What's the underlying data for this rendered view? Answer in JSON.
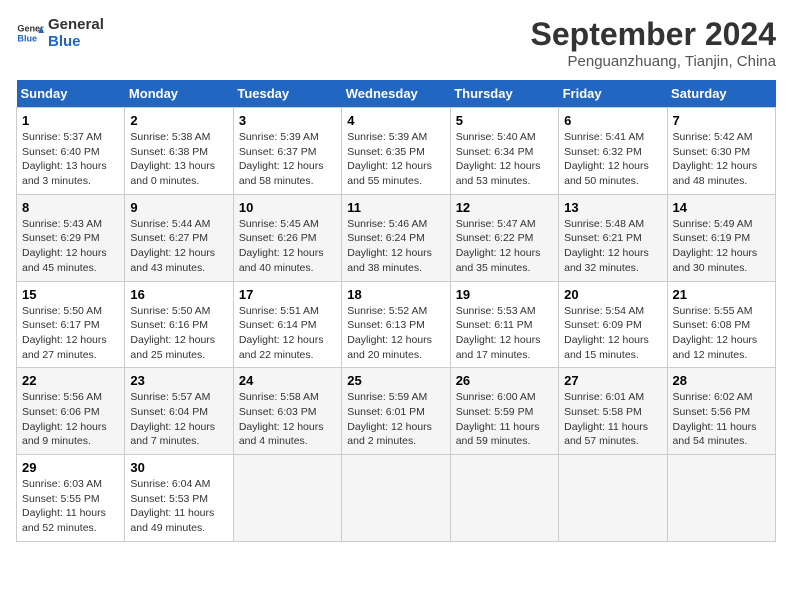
{
  "header": {
    "logo_line1": "General",
    "logo_line2": "Blue",
    "title": "September 2024",
    "subtitle": "Penguanzhuang, Tianjin, China"
  },
  "days_of_week": [
    "Sunday",
    "Monday",
    "Tuesday",
    "Wednesday",
    "Thursday",
    "Friday",
    "Saturday"
  ],
  "weeks": [
    [
      {
        "day": "1",
        "info": "Sunrise: 5:37 AM\nSunset: 6:40 PM\nDaylight: 13 hours\nand 3 minutes."
      },
      {
        "day": "2",
        "info": "Sunrise: 5:38 AM\nSunset: 6:38 PM\nDaylight: 13 hours\nand 0 minutes."
      },
      {
        "day": "3",
        "info": "Sunrise: 5:39 AM\nSunset: 6:37 PM\nDaylight: 12 hours\nand 58 minutes."
      },
      {
        "day": "4",
        "info": "Sunrise: 5:39 AM\nSunset: 6:35 PM\nDaylight: 12 hours\nand 55 minutes."
      },
      {
        "day": "5",
        "info": "Sunrise: 5:40 AM\nSunset: 6:34 PM\nDaylight: 12 hours\nand 53 minutes."
      },
      {
        "day": "6",
        "info": "Sunrise: 5:41 AM\nSunset: 6:32 PM\nDaylight: 12 hours\nand 50 minutes."
      },
      {
        "day": "7",
        "info": "Sunrise: 5:42 AM\nSunset: 6:30 PM\nDaylight: 12 hours\nand 48 minutes."
      }
    ],
    [
      {
        "day": "8",
        "info": "Sunrise: 5:43 AM\nSunset: 6:29 PM\nDaylight: 12 hours\nand 45 minutes."
      },
      {
        "day": "9",
        "info": "Sunrise: 5:44 AM\nSunset: 6:27 PM\nDaylight: 12 hours\nand 43 minutes."
      },
      {
        "day": "10",
        "info": "Sunrise: 5:45 AM\nSunset: 6:26 PM\nDaylight: 12 hours\nand 40 minutes."
      },
      {
        "day": "11",
        "info": "Sunrise: 5:46 AM\nSunset: 6:24 PM\nDaylight: 12 hours\nand 38 minutes."
      },
      {
        "day": "12",
        "info": "Sunrise: 5:47 AM\nSunset: 6:22 PM\nDaylight: 12 hours\nand 35 minutes."
      },
      {
        "day": "13",
        "info": "Sunrise: 5:48 AM\nSunset: 6:21 PM\nDaylight: 12 hours\nand 32 minutes."
      },
      {
        "day": "14",
        "info": "Sunrise: 5:49 AM\nSunset: 6:19 PM\nDaylight: 12 hours\nand 30 minutes."
      }
    ],
    [
      {
        "day": "15",
        "info": "Sunrise: 5:50 AM\nSunset: 6:17 PM\nDaylight: 12 hours\nand 27 minutes."
      },
      {
        "day": "16",
        "info": "Sunrise: 5:50 AM\nSunset: 6:16 PM\nDaylight: 12 hours\nand 25 minutes."
      },
      {
        "day": "17",
        "info": "Sunrise: 5:51 AM\nSunset: 6:14 PM\nDaylight: 12 hours\nand 22 minutes."
      },
      {
        "day": "18",
        "info": "Sunrise: 5:52 AM\nSunset: 6:13 PM\nDaylight: 12 hours\nand 20 minutes."
      },
      {
        "day": "19",
        "info": "Sunrise: 5:53 AM\nSunset: 6:11 PM\nDaylight: 12 hours\nand 17 minutes."
      },
      {
        "day": "20",
        "info": "Sunrise: 5:54 AM\nSunset: 6:09 PM\nDaylight: 12 hours\nand 15 minutes."
      },
      {
        "day": "21",
        "info": "Sunrise: 5:55 AM\nSunset: 6:08 PM\nDaylight: 12 hours\nand 12 minutes."
      }
    ],
    [
      {
        "day": "22",
        "info": "Sunrise: 5:56 AM\nSunset: 6:06 PM\nDaylight: 12 hours\nand 9 minutes."
      },
      {
        "day": "23",
        "info": "Sunrise: 5:57 AM\nSunset: 6:04 PM\nDaylight: 12 hours\nand 7 minutes."
      },
      {
        "day": "24",
        "info": "Sunrise: 5:58 AM\nSunset: 6:03 PM\nDaylight: 12 hours\nand 4 minutes."
      },
      {
        "day": "25",
        "info": "Sunrise: 5:59 AM\nSunset: 6:01 PM\nDaylight: 12 hours\nand 2 minutes."
      },
      {
        "day": "26",
        "info": "Sunrise: 6:00 AM\nSunset: 5:59 PM\nDaylight: 11 hours\nand 59 minutes."
      },
      {
        "day": "27",
        "info": "Sunrise: 6:01 AM\nSunset: 5:58 PM\nDaylight: 11 hours\nand 57 minutes."
      },
      {
        "day": "28",
        "info": "Sunrise: 6:02 AM\nSunset: 5:56 PM\nDaylight: 11 hours\nand 54 minutes."
      }
    ],
    [
      {
        "day": "29",
        "info": "Sunrise: 6:03 AM\nSunset: 5:55 PM\nDaylight: 11 hours\nand 52 minutes."
      },
      {
        "day": "30",
        "info": "Sunrise: 6:04 AM\nSunset: 5:53 PM\nDaylight: 11 hours\nand 49 minutes."
      },
      {
        "day": "",
        "info": ""
      },
      {
        "day": "",
        "info": ""
      },
      {
        "day": "",
        "info": ""
      },
      {
        "day": "",
        "info": ""
      },
      {
        "day": "",
        "info": ""
      }
    ]
  ]
}
